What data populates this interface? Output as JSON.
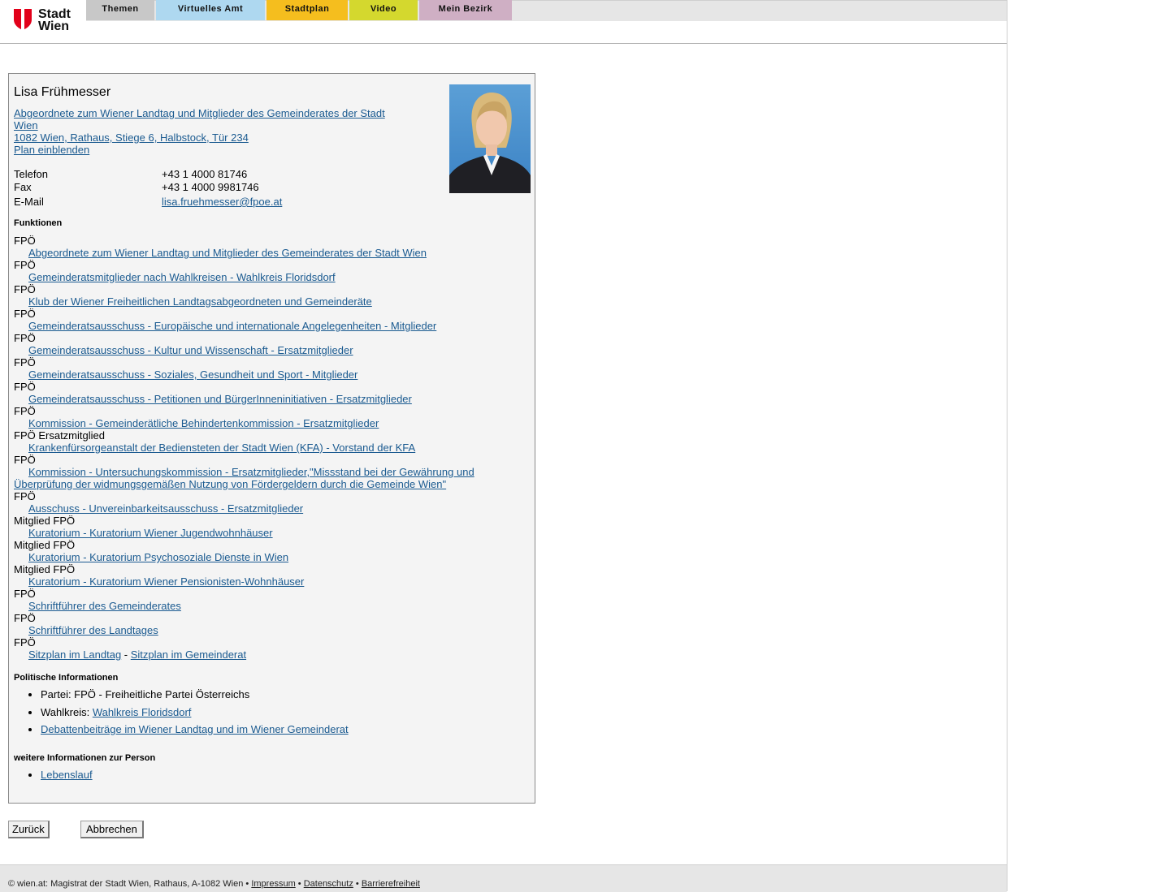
{
  "header": {
    "logo_line1": "Stadt",
    "logo_line2": "Wien",
    "tabs": [
      {
        "label": "Themen",
        "color": "#c8c8c8"
      },
      {
        "label": "Virtuelles Amt",
        "color": "#aed8f0"
      },
      {
        "label": "Stadtplan",
        "color": "#f5be1e"
      },
      {
        "label": "Video",
        "color": "#d4d82e"
      },
      {
        "label": "Mein Bezirk",
        "color": "#cfafc4"
      }
    ]
  },
  "person": {
    "name": "Lisa Frühmesser",
    "office_line1": "Abgeordnete zum Wiener Landtag und Mitglieder des Gemeinderates der Stadt",
    "office_line2": "Wien ",
    "address": "1082 Wien, Rathaus, Stiege 6, Halbstock, Tür 234",
    "plan_link": "Plan einblenden",
    "contact": {
      "phone_label": "Telefon",
      "phone": "+43 1 4000 81746",
      "fax_label": "Fax",
      "fax": "+43 1 4000 9981746",
      "email_label": "E-Mail",
      "email": "lisa.fruehmesser@fpoe.at"
    }
  },
  "functions": {
    "heading": "Funktionen",
    "items": [
      {
        "party": "FPÖ",
        "link": "Abgeordnete zum Wiener Landtag und Mitglieder des Gemeinderates der Stadt Wien"
      },
      {
        "party": "FPÖ",
        "link": "Gemeinderatsmitglieder nach Wahlkreisen - Wahlkreis Floridsdorf"
      },
      {
        "party": "FPÖ",
        "link": "Klub der Wiener Freiheitlichen Landtagsabgeordneten und Gemeinderäte"
      },
      {
        "party": "FPÖ",
        "link": "Gemeinderatsausschuss - Europäische und internationale Angelegenheiten - Mitglieder"
      },
      {
        "party": "FPÖ",
        "link": "Gemeinderatsausschuss - Kultur und Wissenschaft - Ersatzmitglieder"
      },
      {
        "party": "FPÖ",
        "link": "Gemeinderatsausschuss - Soziales, Gesundheit und Sport - Mitglieder"
      },
      {
        "party": "FPÖ",
        "link": "Gemeinderatsausschuss - Petitionen und BürgerInneninitiativen - Ersatzmitglieder"
      },
      {
        "party": "FPÖ",
        "link": "Kommission - Gemeinderätliche Behindertenkommission - Ersatzmitglieder"
      },
      {
        "party": "FPÖ Ersatzmitglied",
        "link": "Krankenfürsorgeanstalt der Bediensteten der Stadt Wien (KFA) - Vorstand der KFA"
      },
      {
        "party": "FPÖ",
        "link_line1": "Kommission - Untersuchungskommission - Ersatzmitglieder,\"Missstand bei der Gewährung und",
        "link_line2": "Überprüfung der widmungsgemäßen Nutzung von Fördergeldern durch die Gemeinde Wien\""
      },
      {
        "party": "FPÖ",
        "link": "Ausschuss - Unvereinbarkeitsausschuss - Ersatzmitglieder"
      },
      {
        "party": "Mitglied FPÖ",
        "link": "Kuratorium - Kuratorium Wiener Jugendwohnhäuser"
      },
      {
        "party": "Mitglied FPÖ",
        "link": "Kuratorium - Kuratorium Psychosoziale Dienste in Wien"
      },
      {
        "party": "Mitglied FPÖ",
        "link": "Kuratorium - Kuratorium Wiener Pensionisten-Wohnhäuser"
      },
      {
        "party": "FPÖ",
        "link": "Schriftführer des Gemeinderates"
      },
      {
        "party": "FPÖ",
        "link": "Schriftführer des Landtages"
      },
      {
        "party": "FPÖ",
        "link_a": "Sitzplan im Landtag",
        "sep": " - ",
        "link_b": "Sitzplan im Gemeinderat"
      }
    ]
  },
  "political": {
    "heading": "Politische Informationen",
    "party": "Partei: FPÖ - Freiheitliche Partei Österreichs",
    "wahlkreis_label": "Wahlkreis: ",
    "wahlkreis_link": "Wahlkreis Floridsdorf",
    "debates_link": "Debattenbeiträge im Wiener Landtag und im Wiener Gemeinderat"
  },
  "further": {
    "heading": "weitere Informationen zur Person",
    "cv_link": "Lebenslauf"
  },
  "buttons": {
    "back": "Zurück",
    "cancel": "Abbrechen"
  },
  "footer": {
    "text": "© wien.at: Magistrat der Stadt Wien, Rathaus, A-1082 Wien • ",
    "impressum": "Impressum",
    "bullet": " • ",
    "datenschutz": "Datenschutz",
    "barrierefreiheit": "Barrierefreiheit"
  }
}
